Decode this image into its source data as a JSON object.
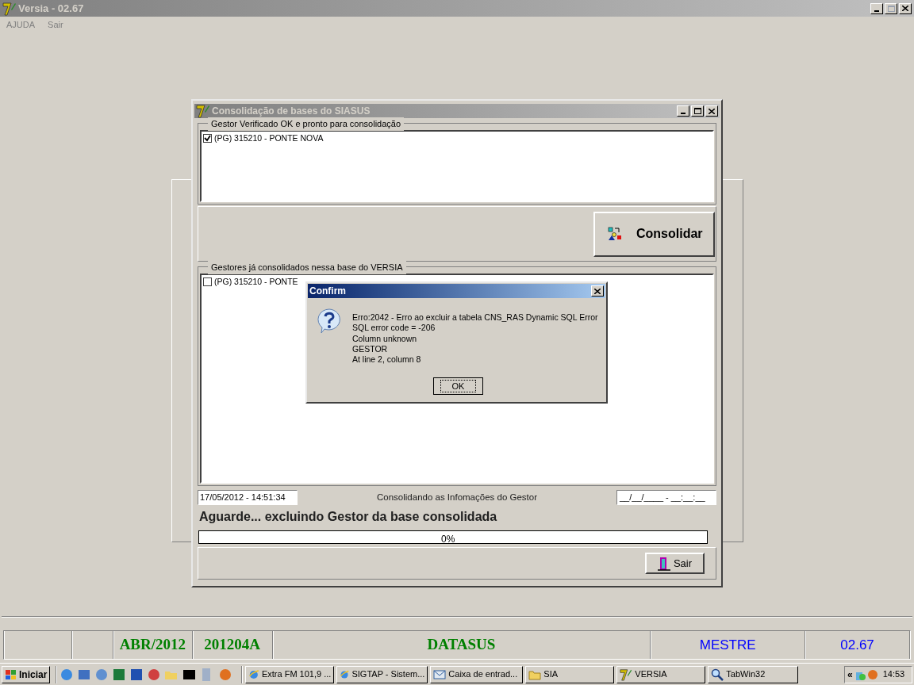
{
  "app_window": {
    "title": "Versia - 02.67",
    "menu": [
      "AJUDA",
      "Sair"
    ]
  },
  "consolidation_window": {
    "title": "Consolidação de bases do SIASUS",
    "ready_group": {
      "label": "Gestor Verificado OK e pronto para consolidação",
      "items": [
        {
          "text": "(PG) 315210 - PONTE NOVA",
          "checked": true
        }
      ]
    },
    "consolidate_button": "Consolidar",
    "done_group": {
      "label": "Gestores já consolidados nessa base do VERSIA",
      "items": [
        {
          "text": "(PG) 315210 - PONTE",
          "checked": false
        }
      ]
    },
    "start_time": "17/05/2012 - 14:51:34",
    "status_label": "Consolidando as Infomações do Gestor",
    "end_time": "__/__/____ - __:__:__",
    "message": "Aguarde... excluindo Gestor da base consolidada",
    "progress": {
      "level": 0,
      "reading": "0%"
    },
    "exit_button": "Sair"
  },
  "dialog": {
    "title": "Confirm",
    "message_lines": [
      "Erro:2042 - Erro ao excluir a tabela CNS_RAS Dynamic SQL Error",
      "SQL error code = -206",
      "Column unknown",
      "GESTOR",
      "At line 2, column 8"
    ],
    "ok_button": "OK"
  },
  "status_bar": [
    {
      "text": "ABR/2012",
      "color": "#008000"
    },
    {
      "text": "201204A",
      "color": "#008000"
    },
    {
      "text": "DATASUS",
      "color": "#008000"
    },
    {
      "text": "MESTRE",
      "color": "#0000ff"
    },
    {
      "text": "02.67",
      "color": "#0000ff"
    }
  ],
  "taskbar": {
    "start": "Iniciar",
    "tasks": [
      {
        "label": "Extra FM 101,9 ...",
        "kind": "browser"
      },
      {
        "label": "SIGTAP - Sistem...",
        "kind": "browser"
      },
      {
        "label": "Caixa de entrad...",
        "kind": "mail"
      },
      {
        "label": "SIA",
        "kind": "folder"
      },
      {
        "label": "VERSIA",
        "kind": "app"
      },
      {
        "label": "TabWin32",
        "kind": "search"
      }
    ],
    "tray_toggle": "«",
    "clock": "14:53"
  }
}
